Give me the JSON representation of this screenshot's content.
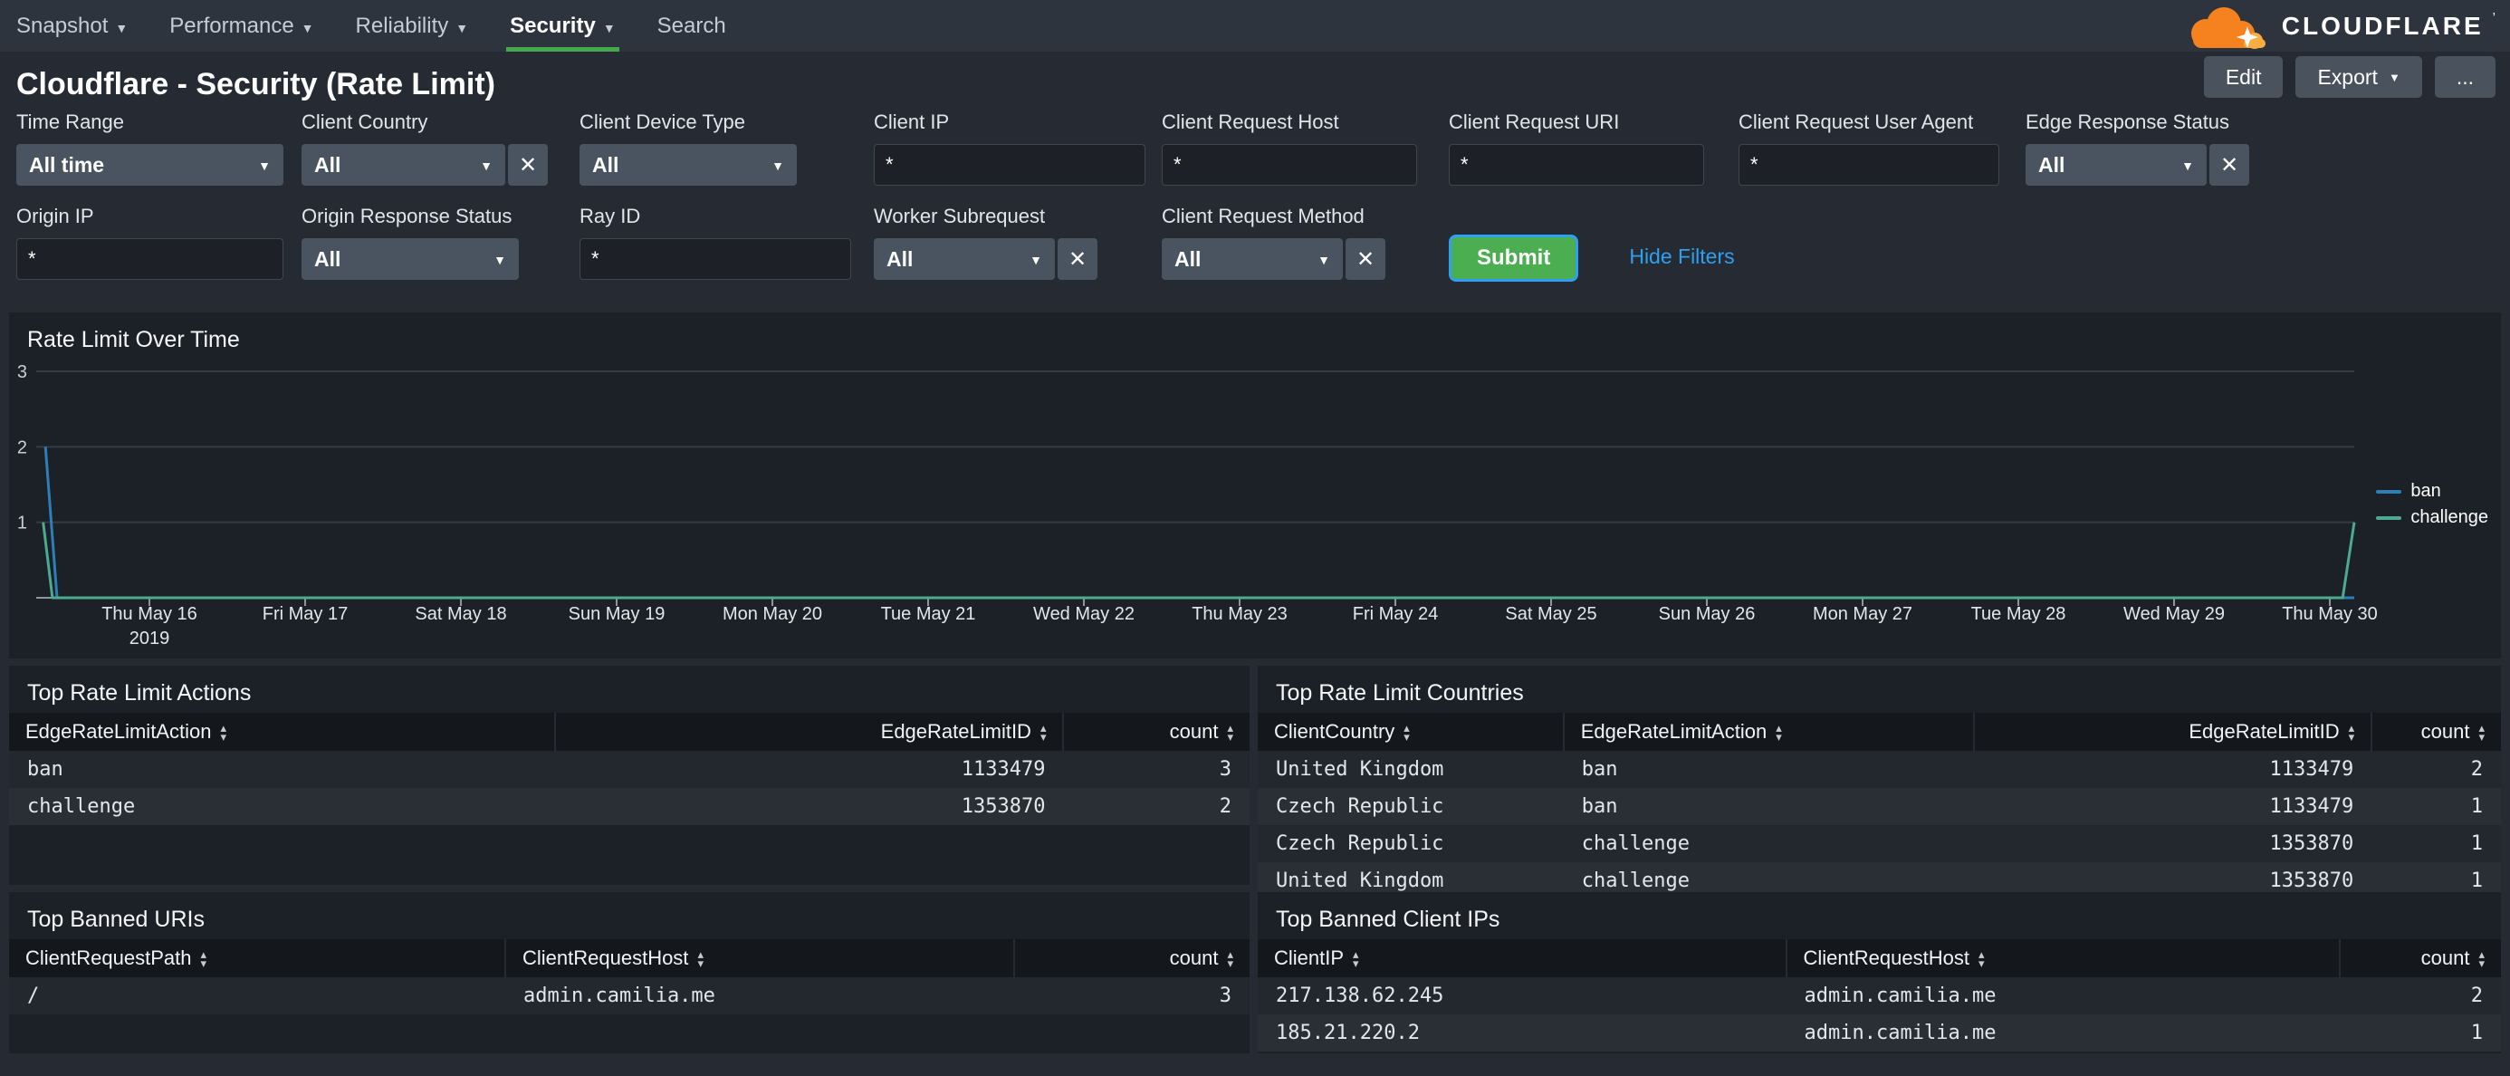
{
  "nav": {
    "items": [
      {
        "label": "Snapshot",
        "caret": true
      },
      {
        "label": "Performance",
        "caret": true
      },
      {
        "label": "Reliability",
        "caret": true
      },
      {
        "label": "Security",
        "caret": true,
        "active": true
      },
      {
        "label": "Search",
        "caret": false
      }
    ]
  },
  "logo": {
    "text": "CLOUDFLARE",
    "mark": "’"
  },
  "header": {
    "title": "Cloudflare - Security (Rate Limit)",
    "buttons": [
      {
        "label": "Edit"
      },
      {
        "label": "Export",
        "caret": true
      },
      {
        "label": "..."
      }
    ]
  },
  "filters": {
    "row1": [
      {
        "label": "Time Range",
        "type": "select",
        "value": "All time",
        "clear": false
      },
      {
        "label": "Client Country",
        "type": "select",
        "value": "All",
        "clear": true
      },
      {
        "label": "Client Device Type",
        "type": "select",
        "value": "All",
        "clear": false
      },
      {
        "label": "Client IP",
        "type": "input",
        "value": "*"
      },
      {
        "label": "Client Request Host",
        "type": "input",
        "value": "*"
      },
      {
        "label": "Client Request URI",
        "type": "input",
        "value": "*"
      },
      {
        "label": "Client Request User Agent",
        "type": "input",
        "value": "*"
      },
      {
        "label": "Edge Response Status",
        "type": "select",
        "value": "All",
        "clear": true
      }
    ],
    "row2": [
      {
        "label": "Origin IP",
        "type": "input",
        "value": "*"
      },
      {
        "label": "Origin Response Status",
        "type": "select",
        "value": "All",
        "clear": false
      },
      {
        "label": "Ray ID",
        "type": "input",
        "value": "*"
      },
      {
        "label": "Worker Subrequest",
        "type": "select",
        "value": "All",
        "clear": true
      },
      {
        "label": "Client Request Method",
        "type": "select",
        "value": "All",
        "clear": true
      }
    ],
    "submit_label": "Submit",
    "hide_filters_label": "Hide Filters"
  },
  "chart_data": {
    "type": "line",
    "title": "Rate Limit Over Time",
    "categories": [
      "Thu May 16",
      "Fri May 17",
      "Sat May 18",
      "Sun May 19",
      "Mon May 20",
      "Tue May 21",
      "Wed May 22",
      "Thu May 23",
      "Fri May 24",
      "Sat May 25",
      "Sun May 26",
      "Mon May 27",
      "Tue May 28",
      "Wed May 29",
      "Thu May 30"
    ],
    "first_category_sublabel": "2019",
    "ylim": [
      0,
      3
    ],
    "yticks": [
      1,
      2,
      3
    ],
    "grid": true,
    "legend_position": "right",
    "series": [
      {
        "name": "ban",
        "color": "#2d7fb8",
        "points": [
          [
            0.4,
            2
          ],
          [
            0.9,
            0
          ],
          [
            100,
            0
          ]
        ]
      },
      {
        "name": "challenge",
        "color": "#4caa8e",
        "points": [
          [
            0.3,
            1
          ],
          [
            0.7,
            0
          ],
          [
            99.5,
            0
          ],
          [
            100,
            1
          ]
        ]
      }
    ]
  },
  "tables": [
    {
      "title": "Top Rate Limit Actions",
      "columns": [
        {
          "label": "EdgeRateLimitAction",
          "align": "left"
        },
        {
          "label": "EdgeRateLimitID",
          "align": "right"
        },
        {
          "label": "count",
          "align": "right"
        }
      ],
      "rows": [
        [
          "ban",
          "1133479",
          "3"
        ],
        [
          "challenge",
          "1353870",
          "2"
        ]
      ]
    },
    {
      "title": "Top Rate Limit Countries",
      "columns": [
        {
          "label": "ClientCountry",
          "align": "left"
        },
        {
          "label": "EdgeRateLimitAction",
          "align": "left"
        },
        {
          "label": "EdgeRateLimitID",
          "align": "right"
        },
        {
          "label": "count",
          "align": "right"
        }
      ],
      "rows": [
        [
          "United Kingdom",
          "ban",
          "1133479",
          "2"
        ],
        [
          "Czech Republic",
          "ban",
          "1133479",
          "1"
        ],
        [
          "Czech Republic",
          "challenge",
          "1353870",
          "1"
        ],
        [
          "United Kingdom",
          "challenge",
          "1353870",
          "1"
        ]
      ]
    },
    {
      "title": "Top Banned URIs",
      "columns": [
        {
          "label": "ClientRequestPath",
          "align": "left"
        },
        {
          "label": "ClientRequestHost",
          "align": "left"
        },
        {
          "label": "count",
          "align": "right"
        }
      ],
      "rows": [
        [
          "/",
          "admin.camilia.me",
          "3"
        ]
      ]
    },
    {
      "title": "Top Banned Client IPs",
      "columns": [
        {
          "label": "ClientIP",
          "align": "left"
        },
        {
          "label": "ClientRequestHost",
          "align": "left"
        },
        {
          "label": "count",
          "align": "right"
        }
      ],
      "rows": [
        [
          "217.138.62.245",
          "admin.camilia.me",
          "2"
        ],
        [
          "185.21.220.2",
          "admin.camilia.me",
          "1"
        ]
      ]
    }
  ],
  "colors": {
    "accent_green": "#46a84b",
    "submit_green": "#4bae50",
    "link_blue": "#2f9ff0",
    "series_ban": "#2d7fb8",
    "series_challenge": "#4caa8e",
    "logo_orange": "#f6821f",
    "logo_orange_light": "#fbad41"
  }
}
